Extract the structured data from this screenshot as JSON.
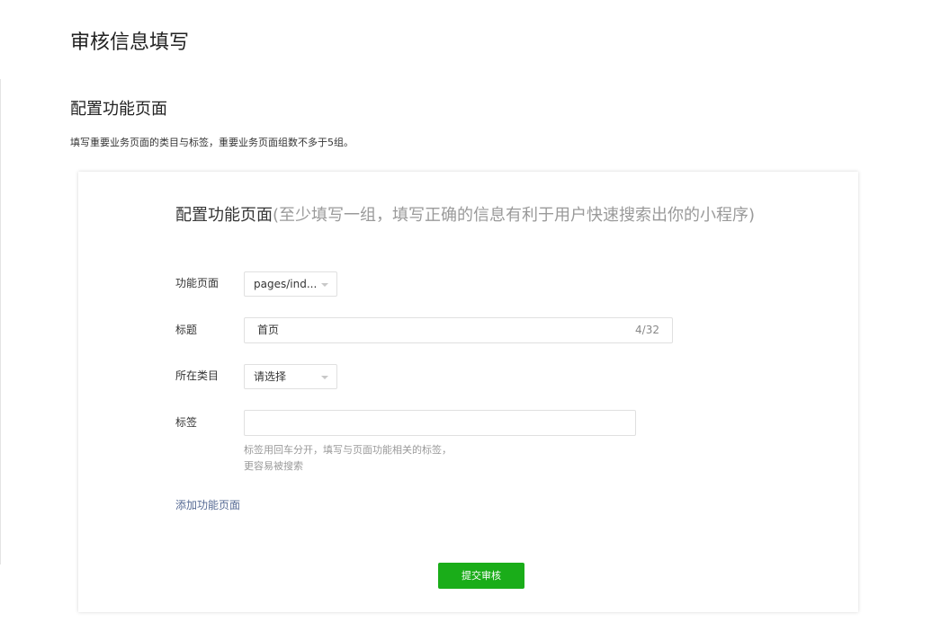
{
  "page": {
    "title": "审核信息填写"
  },
  "section": {
    "title": "配置功能页面",
    "description": "填写重要业务页面的类目与标签，重要业务页面组数不多于5组。"
  },
  "card": {
    "heading_strong": "配置功能页面",
    "heading_hint": "(至少填写一组，填写正确的信息有利于用户快速搜索出你的小程序)"
  },
  "form": {
    "page_field": {
      "label": "功能页面",
      "value": "pages/ind..."
    },
    "title_field": {
      "label": "标题",
      "value": "首页",
      "counter": "4/32"
    },
    "category_field": {
      "label": "所在类目",
      "value": "请选择"
    },
    "tags_field": {
      "label": "标签",
      "value": "",
      "help_line1": "标签用回车分开，填写与页面功能相关的标签，",
      "help_line2": "更容易被搜索"
    }
  },
  "actions": {
    "add_page_link": "添加功能页面",
    "submit_label": "提交审核"
  },
  "colors": {
    "primary_green": "#1aad19",
    "link_blue": "#576b95",
    "hint_gray": "#9a9a9a"
  },
  "icons": {
    "dropdown": "caret-down-icon"
  }
}
